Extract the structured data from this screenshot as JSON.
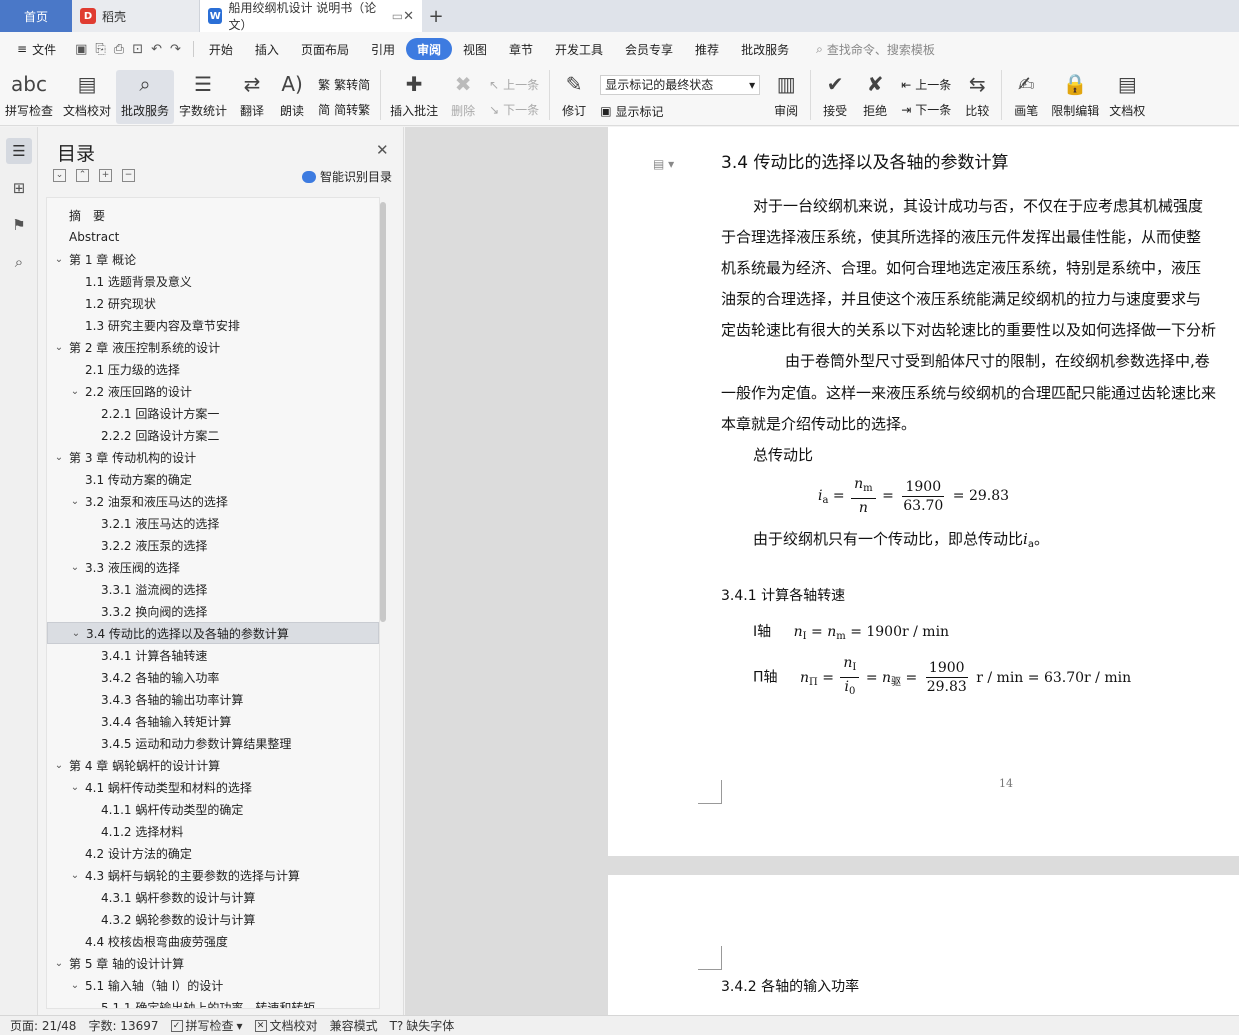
{
  "tabs": {
    "home": "首页",
    "daoke": "稻壳",
    "doc_title": "船用绞纲机设计 说明书（论文）",
    "add": "+"
  },
  "menu": {
    "file": "文件",
    "items": [
      "开始",
      "插入",
      "页面布局",
      "引用",
      "审阅",
      "视图",
      "章节",
      "开发工具",
      "会员专享",
      "推荐",
      "批改服务"
    ],
    "active": "审阅",
    "search_placeholder": "查找命令、搜索模板"
  },
  "ribbon": {
    "spell_check": "拼写检查",
    "doc_proof": "文档校对",
    "correction_service": "批改服务",
    "word_count": "字数统计",
    "translate": "翻译",
    "read_aloud": "朗读",
    "trad_simp": "繁转简",
    "simp_trad": "简转繁",
    "insert_comment": "插入批注",
    "delete": "删除",
    "prev_item": "上一条",
    "next_item": "下一条",
    "revise": "修订",
    "markup_select": "显示标记的最终状态",
    "show_markup": "显示标记",
    "review": "审阅",
    "accept": "接受",
    "reject": "拒绝",
    "prev": "上一条",
    "next": "下一条",
    "compare": "比较",
    "pen": "画笔",
    "restrict_edit": "限制编辑",
    "doc_perm": "文档权"
  },
  "toc": {
    "title": "目录",
    "smart": "智能识别目录",
    "items": [
      {
        "text": "摘　要",
        "level": 0,
        "chev": ""
      },
      {
        "text": "Abstract",
        "level": 0,
        "chev": ""
      },
      {
        "text": "第 1 章  概论",
        "level": 0,
        "chev": "v"
      },
      {
        "text": "1.1 选题背景及意义",
        "level": 1,
        "chev": ""
      },
      {
        "text": "1.2 研究现状",
        "level": 1,
        "chev": ""
      },
      {
        "text": "1.3 研究主要内容及章节安排",
        "level": 1,
        "chev": ""
      },
      {
        "text": "第 2 章  液压控制系统的设计",
        "level": 0,
        "chev": "v"
      },
      {
        "text": "2.1 压力级的选择",
        "level": 1,
        "chev": ""
      },
      {
        "text": "2.2  液压回路的设计",
        "level": 1,
        "chev": "v"
      },
      {
        "text": "2.2.1  回路设计方案一",
        "level": 2,
        "chev": ""
      },
      {
        "text": "2.2.2  回路设计方案二",
        "level": 2,
        "chev": ""
      },
      {
        "text": "第 3 章  传动机构的设计",
        "level": 0,
        "chev": "v"
      },
      {
        "text": "3.1 传动方案的确定",
        "level": 1,
        "chev": ""
      },
      {
        "text": "3.2 油泵和液压马达的选择",
        "level": 1,
        "chev": "v"
      },
      {
        "text": "3.2.1  液压马达的选择",
        "level": 2,
        "chev": ""
      },
      {
        "text": "3.2.2  液压泵的选择",
        "level": 2,
        "chev": ""
      },
      {
        "text": "3.3  液压阀的选择",
        "level": 1,
        "chev": "v"
      },
      {
        "text": "3.3.1 溢流阀的选择",
        "level": 2,
        "chev": ""
      },
      {
        "text": "3.3.2  换向阀的选择",
        "level": 2,
        "chev": ""
      },
      {
        "text": "3.4    传动比的选择以及各轴的参数计算",
        "level": 1,
        "chev": "v",
        "selected": true
      },
      {
        "text": "3.4.1    计算各轴转速",
        "level": 2,
        "chev": ""
      },
      {
        "text": "3.4.2    各轴的输入功率",
        "level": 2,
        "chev": ""
      },
      {
        "text": "3.4.3    各轴的输出功率计算",
        "level": 2,
        "chev": ""
      },
      {
        "text": "3.4.4    各轴输入转矩计算",
        "level": 2,
        "chev": ""
      },
      {
        "text": "3.4.5 运动和动力参数计算结果整理",
        "level": 2,
        "chev": ""
      },
      {
        "text": "第 4 章    蜗轮蜗杆的设计计算",
        "level": 0,
        "chev": "v"
      },
      {
        "text": "4.1    蜗杆传动类型和材料的选择",
        "level": 1,
        "chev": "v"
      },
      {
        "text": "4.1.1    蜗杆传动类型的确定",
        "level": 2,
        "chev": ""
      },
      {
        "text": "4.1.2    选择材料",
        "level": 2,
        "chev": ""
      },
      {
        "text": "4.2  设计方法的确定",
        "level": 1,
        "chev": ""
      },
      {
        "text": "4.3    蜗杆与蜗轮的主要参数的选择与计算",
        "level": 1,
        "chev": "v"
      },
      {
        "text": "4.3.1    蜗杆参数的设计与计算",
        "level": 2,
        "chev": ""
      },
      {
        "text": "4.3.2    蜗轮参数的设计与计算",
        "level": 2,
        "chev": ""
      },
      {
        "text": "4.4    校核齿根弯曲疲劳强度",
        "level": 1,
        "chev": ""
      },
      {
        "text": "第 5 章    轴的设计计算",
        "level": 0,
        "chev": "v"
      },
      {
        "text": "5.1    输入轴（轴 I）的设计",
        "level": 1,
        "chev": "v"
      },
      {
        "text": "5.1.1    确定输出轴上的功率、转速和转矩",
        "level": 2,
        "chev": ""
      }
    ]
  },
  "doc": {
    "heading": "3.4    传动比的选择以及各轴的参数计算",
    "paras": [
      "对于一台绞纲机来说，其设计成功与否，不仅在于应考虑其机械强度",
      "于合理选择液压系统，使其所选择的液压元件发挥出最佳性能，从而使整",
      "机系统最为经济、合理。如何合理地选定液压系统，特别是系统中，液压",
      "油泵的合理选择，并且使这个液压系统能满足绞纲机的拉力与速度要求与",
      "定齿轮速比有很大的关系以下对齿轮速比的重要性以及如何选择做一下分析",
      "由于卷筒外型尺寸受到船体尺寸的限制，在绞纲机参数选择中,卷",
      "一般作为定值。这样一来液压系统与绞纲机的合理匹配只能通过齿轮速比来",
      "本章就是介绍传动比的选择。",
      "总传动比"
    ],
    "eq1": {
      "lhs": "i",
      "lhs_sub": "a",
      "n_num": "n",
      "n_num_sub": "m",
      "n_den": "n",
      "v_num": "1900",
      "v_den": "63.70",
      "result": "= 29.83"
    },
    "after_eq": "由于绞纲机只有一个传动比，即总传动比",
    "after_eq_var": "i",
    "after_eq_var_sub": "a",
    "after_eq_end": "。",
    "sec_341": "3.4.1    计算各轴转速",
    "axis1_label": "Ⅰ轴",
    "axis1_eq": {
      "lhs_sub": "Ⅰ",
      "rhs_sub": "m",
      "result": "= 1900r / min"
    },
    "axis2_label": "Π轴",
    "axis2_eq": {
      "lhs_sub": "Π",
      "num_sub": "Ⅰ",
      "den": "i",
      "den_sub": "0",
      "mid_sub": "驱",
      "v_num": "1900",
      "v_den": "29.83",
      "result": "r / min = 63.70r / min"
    },
    "page_number": "14",
    "sec_342": "3.4.2    各轴的输入功率"
  },
  "status": {
    "page": "页面: 21/48",
    "words": "字数: 13697",
    "spell": "拼写检查",
    "proof": "文档校对",
    "compat": "兼容模式",
    "missing_font": "缺失字体"
  }
}
